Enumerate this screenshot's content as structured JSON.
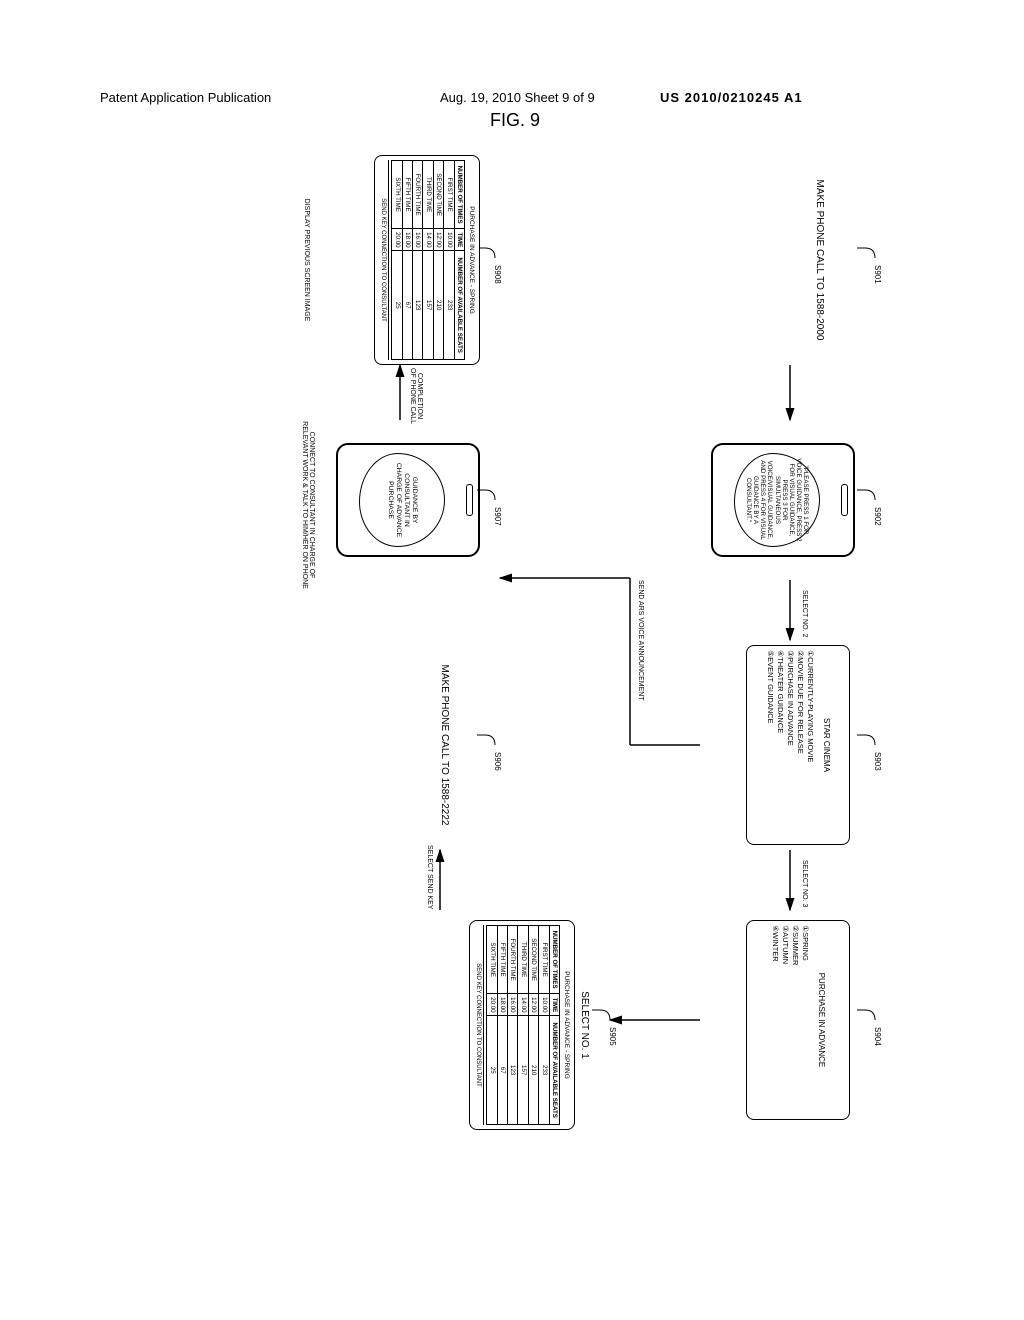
{
  "header": {
    "left": "Patent Application Publication",
    "mid": "Aug. 19, 2010  Sheet 9 of 9",
    "right": "US 2010/0210245 A1"
  },
  "figure_label": "FIG. 9",
  "steps": {
    "s901": {
      "ref": "S901",
      "text": "MAKE PHONE CALL TO\n1588-2000"
    },
    "s902": {
      "ref": "S902",
      "bubble": "\"PLEASE PRESS 1 FOR VOICE GUIDANCE, PRESS 2 FOR VISUAL GUIDANCE, PRESS 3 FOR SIMULTANEOUS VOICE/VISUAL GUIDANCE, AND PRESS 4 FOR VISUAL GUIDANCE BY A CONSULTANT.\""
    },
    "s903": {
      "ref": "S903",
      "title": "STAR CINEMA",
      "items": [
        "CURRENTLY-PLAYING MOVIE",
        "MOVIE DUE FOR RELEASE",
        "PURCHASE IN ADVANCE",
        "THEATER GUIDANCE",
        "EVENT GUIDANCE"
      ]
    },
    "s904": {
      "ref": "S904",
      "title": "PURCHASE IN ADVANCE",
      "items": [
        "SPRING",
        "SUMMER",
        "AUTUMN",
        "WINTER"
      ]
    },
    "s905": {
      "ref": "S905",
      "title": "SELECT NO. 1",
      "caption": "PURCHASE IN ADVANCE - SPRING",
      "headers": [
        "NUMBER OF TIMES",
        "TIME",
        "NUMBER OF AVAILABLE SEATS"
      ],
      "rows": [
        [
          "FIRST TIME",
          "10:00",
          "233"
        ],
        [
          "SECOND TIME",
          "12:00",
          "210"
        ],
        [
          "THIRD TIME",
          "14:00",
          "157"
        ],
        [
          "FOURTH TIME",
          "16:00",
          "123"
        ],
        [
          "FIFTH TIME",
          "18:00",
          "67"
        ],
        [
          "SIXTH TIME",
          "20:00",
          "25"
        ]
      ],
      "footer": "SEND KEY  CONNECTION TO CONSULTANT"
    },
    "s906": {
      "ref": "S906",
      "text": "MAKE PHONE CALL TO\n1588-2222"
    },
    "s907": {
      "ref": "S907",
      "bubble": "GUIDANCE BY CONSULTANT IN CHARGE OF ADVANCE PURCHASE"
    },
    "s908": {
      "ref": "S908",
      "caption": "PURCHASE IN ADVANCE - SPRING",
      "headers": [
        "NUMBER OF TIMES",
        "TIME",
        "NUMBER OF AVAILABLE SEATS"
      ],
      "rows": [
        [
          "FIRST TIME",
          "10:00",
          "233"
        ],
        [
          "SECOND TIME",
          "12:00",
          "210"
        ],
        [
          "THIRD TIME",
          "14:00",
          "157"
        ],
        [
          "FOURTH TIME",
          "16:00",
          "123"
        ],
        [
          "FIFTH TIME",
          "18:00",
          "67"
        ],
        [
          "SIXTH TIME",
          "20:00",
          "25"
        ]
      ],
      "footer": "SEND KEY  CONNECTION TO CONSULTANT"
    }
  },
  "arrows": {
    "a_901_902": "",
    "a_902_903": "SELECT NO. 2",
    "a_903_904": "SELECT NO. 3",
    "a_904_905": "",
    "a_905_906": "SELECT SEND KEY",
    "a_903_907": "SEND ARS VOICE ANNOUNCEMENT",
    "a_907_908": "COMPLETION\nOF PHONE CALL"
  },
  "footers": {
    "f908": "DISPLAY PREVIOUS SCREEN IMAGE",
    "f907": "CONNECT TO CONSULTANT IN CHARGE OF\nRELEVANT WORK & TALK TO HIM/HER ON PHONE"
  }
}
